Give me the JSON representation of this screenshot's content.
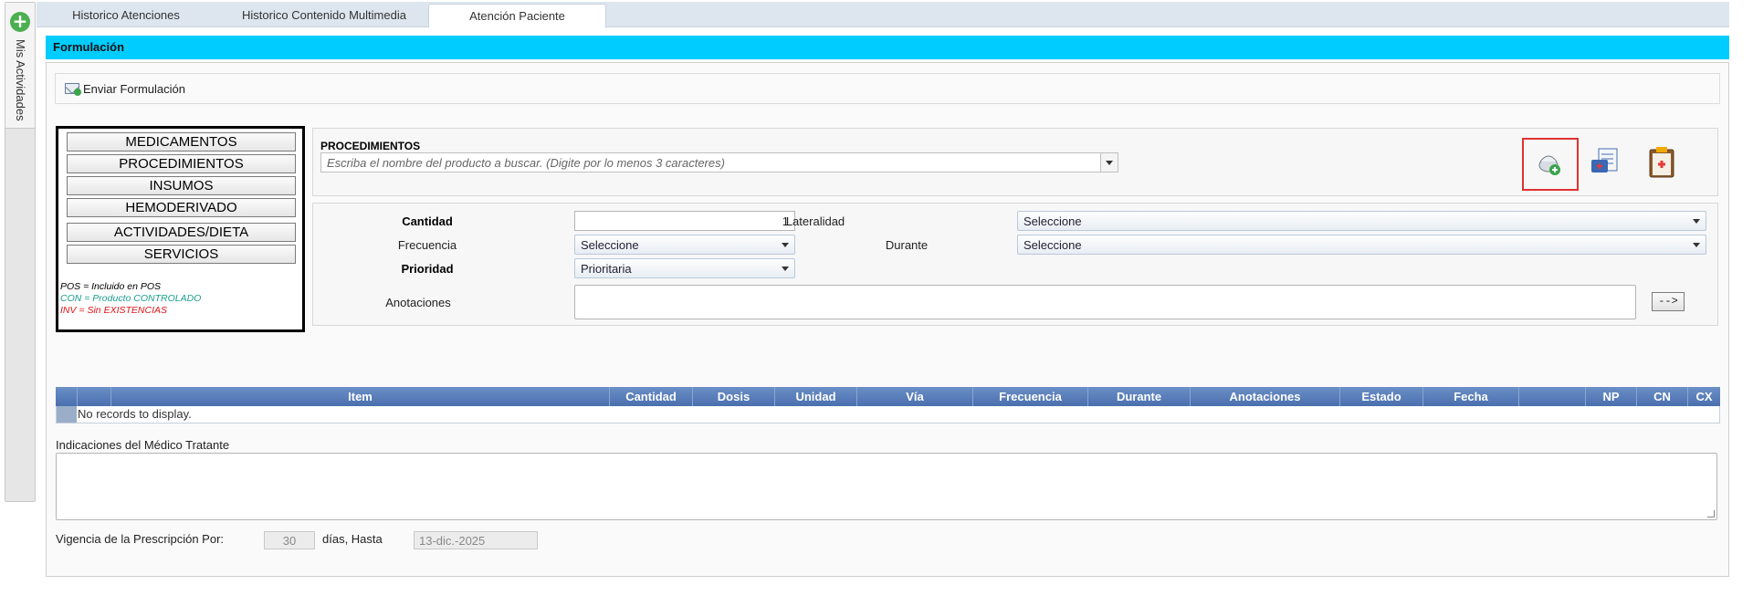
{
  "side_panel": {
    "label": "Mis Actividades",
    "add_icon": "plus-circle-icon"
  },
  "tabs": [
    {
      "label": "Historico Atenciones",
      "active": false
    },
    {
      "label": "Historico Contenido Multimedia",
      "active": false
    },
    {
      "label": "Atención Paciente",
      "active": true
    }
  ],
  "section_title": "Formulación",
  "toolbar": {
    "send_label": "Enviar Formulación",
    "send_icon": "envelope-add-icon"
  },
  "categories": [
    "MEDICAMENTOS",
    "PROCEDIMIENTOS",
    "INSUMOS",
    "HEMODERIVADO",
    "ACTIVIDADES/DIETA",
    "SERVICIOS"
  ],
  "legend": [
    {
      "text": "POS = Incluido en POS",
      "color": "#000000"
    },
    {
      "text": "CON = Producto CONTROLADO",
      "color": "#1a9e8f"
    },
    {
      "text": "INV = Sin EXISTENCIAS",
      "color": "#e0151b"
    }
  ],
  "procedures": {
    "title": "PROCEDIMIENTOS",
    "search_placeholder": "Escriba el nombre del producto a buscar. (Digite por lo menos 3 caracteres)",
    "icons": [
      "add-product-icon",
      "medical-checklist-icon",
      "clipboard-medical-icon"
    ]
  },
  "form": {
    "cantidad_label": "Cantidad",
    "cantidad_value": "1",
    "lateralidad_label": "Lateralidad",
    "lateralidad_value": "Seleccione",
    "frecuencia_label": "Frecuencia",
    "frecuencia_value": "Seleccione",
    "durante_label": "Durante",
    "durante_value": "Seleccione",
    "prioridad_label": "Prioridad",
    "prioridad_value": "Prioritaria",
    "anotaciones_label": "Anotaciones",
    "arrow_button": "-->"
  },
  "grid": {
    "columns": [
      "",
      "",
      "Item",
      "Cantidad",
      "Dosis",
      "Unidad",
      "Vía",
      "Frecuencia",
      "Durante",
      "Anotaciones",
      "Estado",
      "Fecha",
      "",
      "NP",
      "CN",
      "CX"
    ],
    "empty_text": "No records to display."
  },
  "indicaciones_label": "Indicaciones del Médico Tratante",
  "vigencia": {
    "label": "Vigencia de la Prescripción Por:",
    "days": "30",
    "days_label": "días, Hasta",
    "until": "13-dic.-2025"
  }
}
